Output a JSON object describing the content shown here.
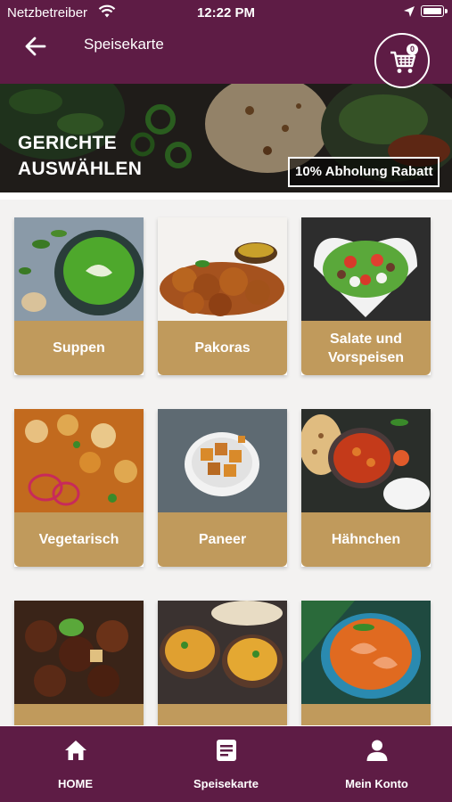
{
  "status_bar": {
    "carrier": "Netzbetreiber",
    "time": "12:22 PM"
  },
  "header": {
    "title": "Speisekarte",
    "cart_count": "0",
    "back_icon": "arrow-left-icon",
    "cart_icon": "cart-icon"
  },
  "hero": {
    "title_line1": "GERICHTE",
    "title_line2": "AUSWÄHLEN",
    "discount_label": "10% Abholung Rabatt"
  },
  "categories": [
    {
      "label": "Suppen"
    },
    {
      "label": "Pakoras"
    },
    {
      "label": "Salate und Vorspeisen"
    },
    {
      "label": "Vegetarisch"
    },
    {
      "label": "Paneer"
    },
    {
      "label": "Hähnchen"
    },
    {
      "label": ""
    },
    {
      "label": ""
    },
    {
      "label": ""
    }
  ],
  "bottom_nav": [
    {
      "label": "HOME",
      "icon": "home-icon"
    },
    {
      "label": "Speisekarte",
      "icon": "menu-icon"
    },
    {
      "label": "Mein Konto",
      "icon": "account-icon"
    }
  ],
  "colors": {
    "primary": "#5e1c45",
    "card_label": "#c09a5c",
    "grid_bg": "#f3f2f1"
  }
}
